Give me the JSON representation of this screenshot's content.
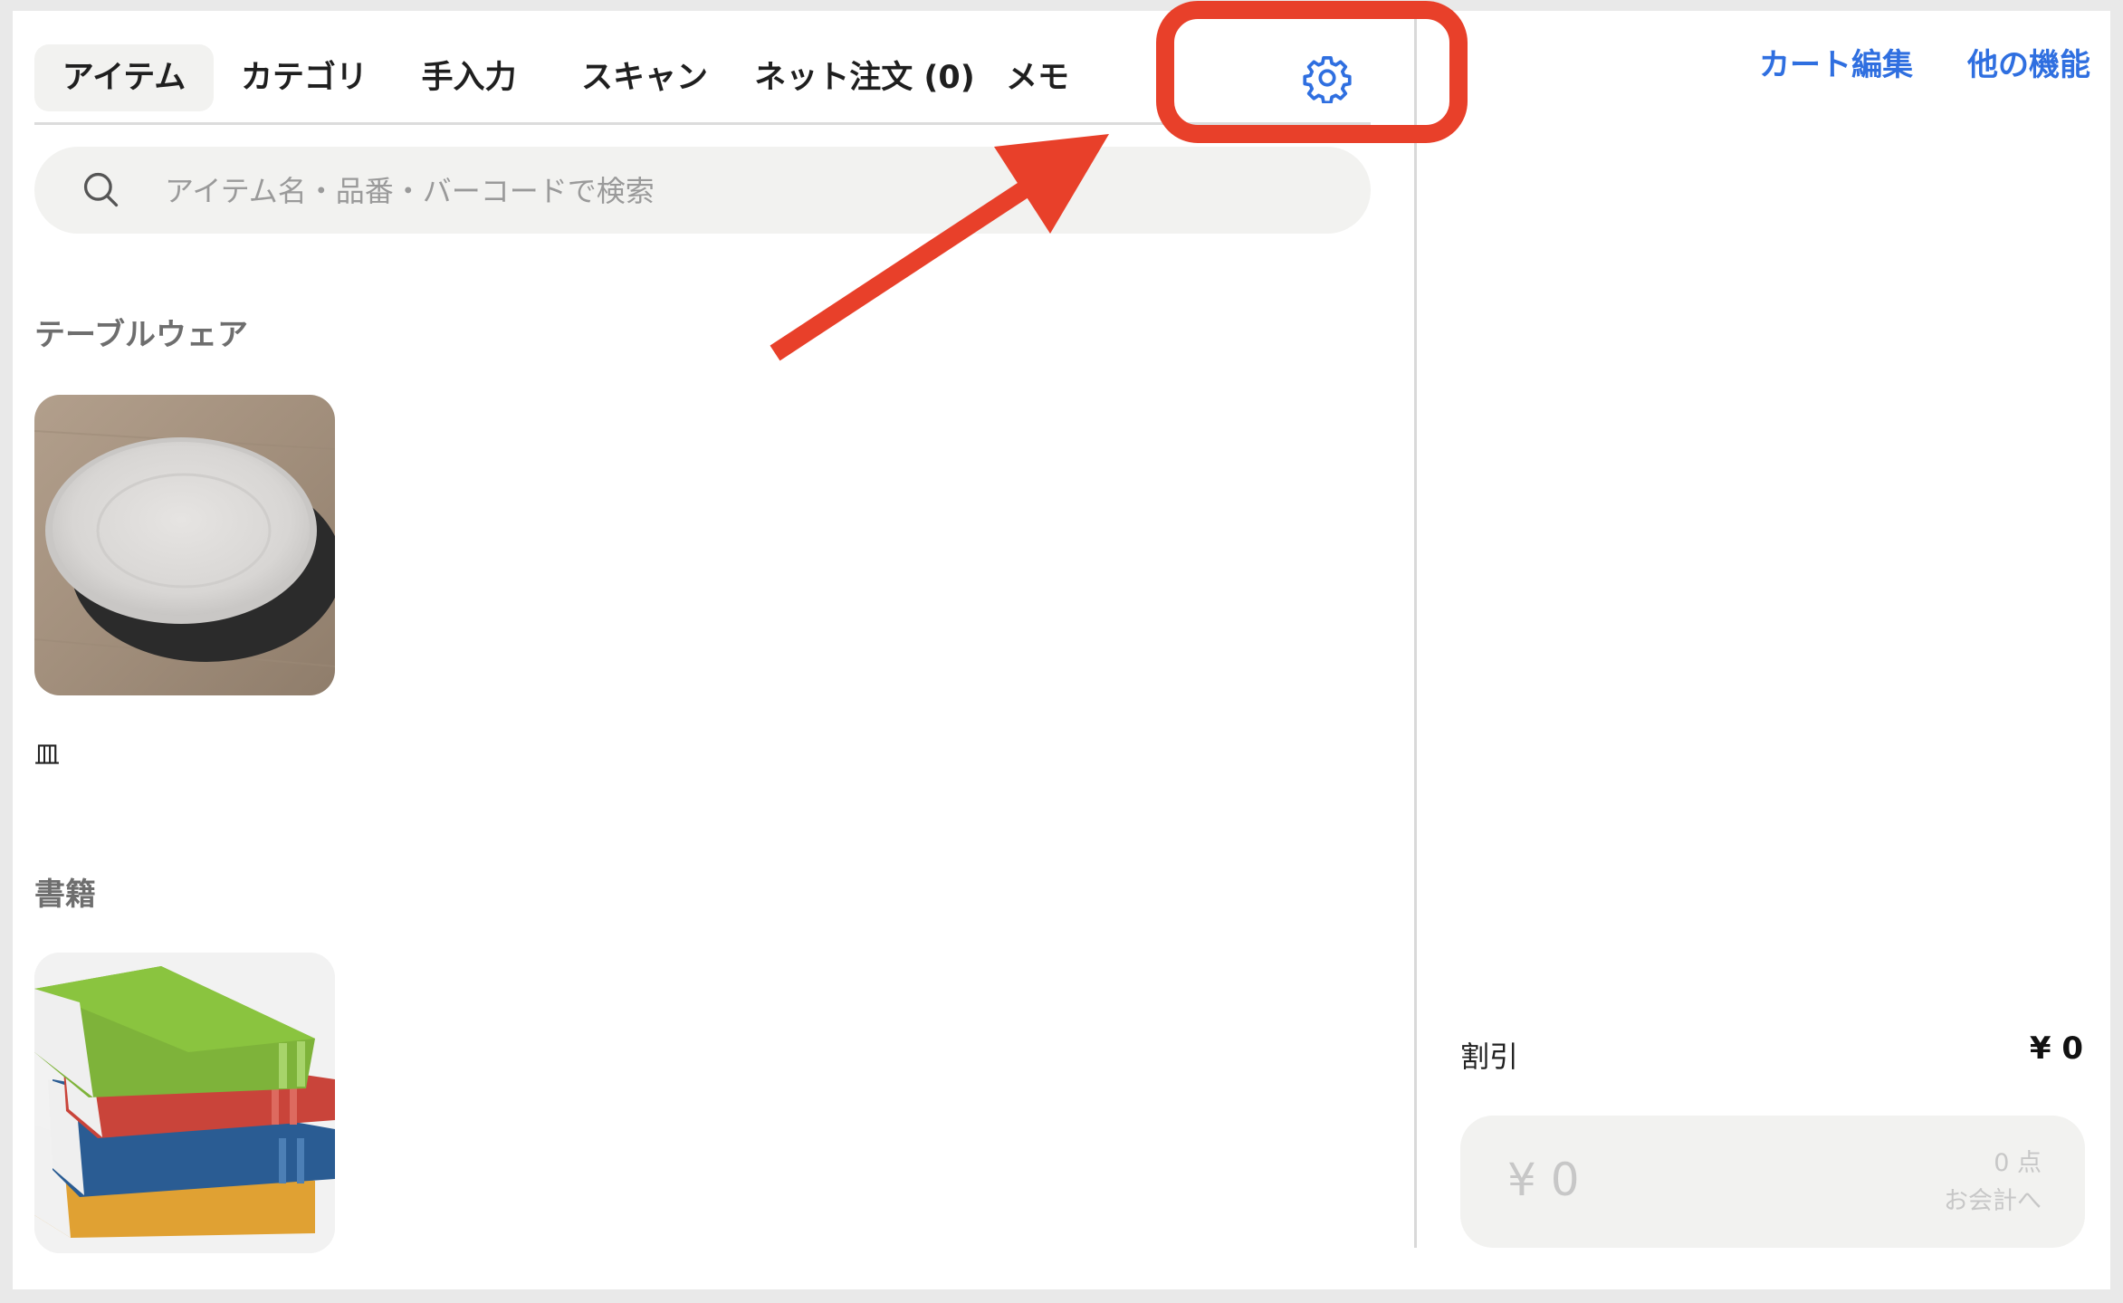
{
  "tabs": [
    {
      "label": "アイテム",
      "active": true
    },
    {
      "label": "カテゴリ",
      "active": false
    },
    {
      "label": "手入力",
      "active": false
    },
    {
      "label": "スキャン",
      "active": false
    },
    {
      "label": "ネット注文 (0)",
      "active": false
    },
    {
      "label": "メモ",
      "active": false
    }
  ],
  "settings_icon": "gear-icon",
  "search": {
    "placeholder": "アイテム名・品番・バーコードで検索",
    "value": ""
  },
  "sections": [
    {
      "title": "テーブルウェア",
      "items": [
        {
          "label": "皿",
          "icon": "plate-image"
        }
      ]
    },
    {
      "title": "書籍",
      "items": [
        {
          "label": "",
          "icon": "books-image"
        }
      ]
    }
  ],
  "header_right": {
    "cart_edit": "カート編集",
    "other_functions": "他の機能"
  },
  "cart": {
    "discount_label": "割引",
    "discount_value": "¥ 0",
    "checkout": {
      "total": "¥ 0",
      "count": "0 点",
      "label": "お会計へ"
    }
  },
  "colors": {
    "accent": "#2f6fe0",
    "annotation": "#e8402a"
  }
}
